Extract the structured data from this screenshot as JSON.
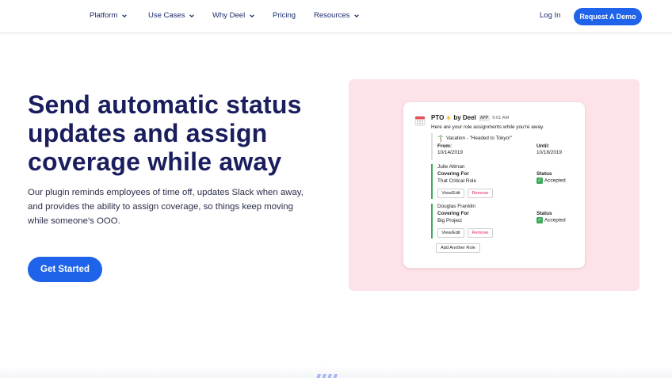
{
  "nav": {
    "items": [
      {
        "label": "Platform",
        "chevron": true
      },
      {
        "label": "Use Cases",
        "chevron": true
      },
      {
        "label": "Why Deel",
        "chevron": true
      },
      {
        "label": "Pricing",
        "chevron": false
      },
      {
        "label": "Resources",
        "chevron": true
      }
    ],
    "login": "Log In",
    "demo": "Request A Demo"
  },
  "hero": {
    "headline": "Send automatic status updates and assign coverage while away",
    "subtext": "Our plugin reminds employees of time off, updates Slack when away, and provides the ability to assign coverage, so things keep moving while someone's OOO.",
    "cta": "Get Started"
  },
  "slack": {
    "app_name": "PTO",
    "bolt_icon": "lightning-icon",
    "by": "by Deel",
    "app_tag": "APP",
    "time": "9:01 AM",
    "intro": "Here are your role assignments while you're away.",
    "vacation": "Vacation - \"Headed to Tokyo!\"",
    "from_label": "From:",
    "from_value": "10/14/2019",
    "until_label": "Until:",
    "until_value": "10/18/2019",
    "roles": [
      {
        "person": "Julie Altman",
        "covering_label": "Covering For",
        "role": "That Critical Role",
        "status_label": "Status",
        "status": "Accepted",
        "edit": "View/Edit",
        "remove": "Remove"
      },
      {
        "person": "Douglas Franklin",
        "covering_label": "Covering For",
        "role": "Big Project",
        "status_label": "Status",
        "status": "Accepted",
        "edit": "View/Edit",
        "remove": "Remove"
      }
    ],
    "add_role": "Add Another Role"
  },
  "colors": {
    "accent": "#1e63e9",
    "heading": "#1a1e5e",
    "panel": "#fde2e8",
    "accepted": "#3daa5c",
    "remove": "#e01e5a"
  }
}
